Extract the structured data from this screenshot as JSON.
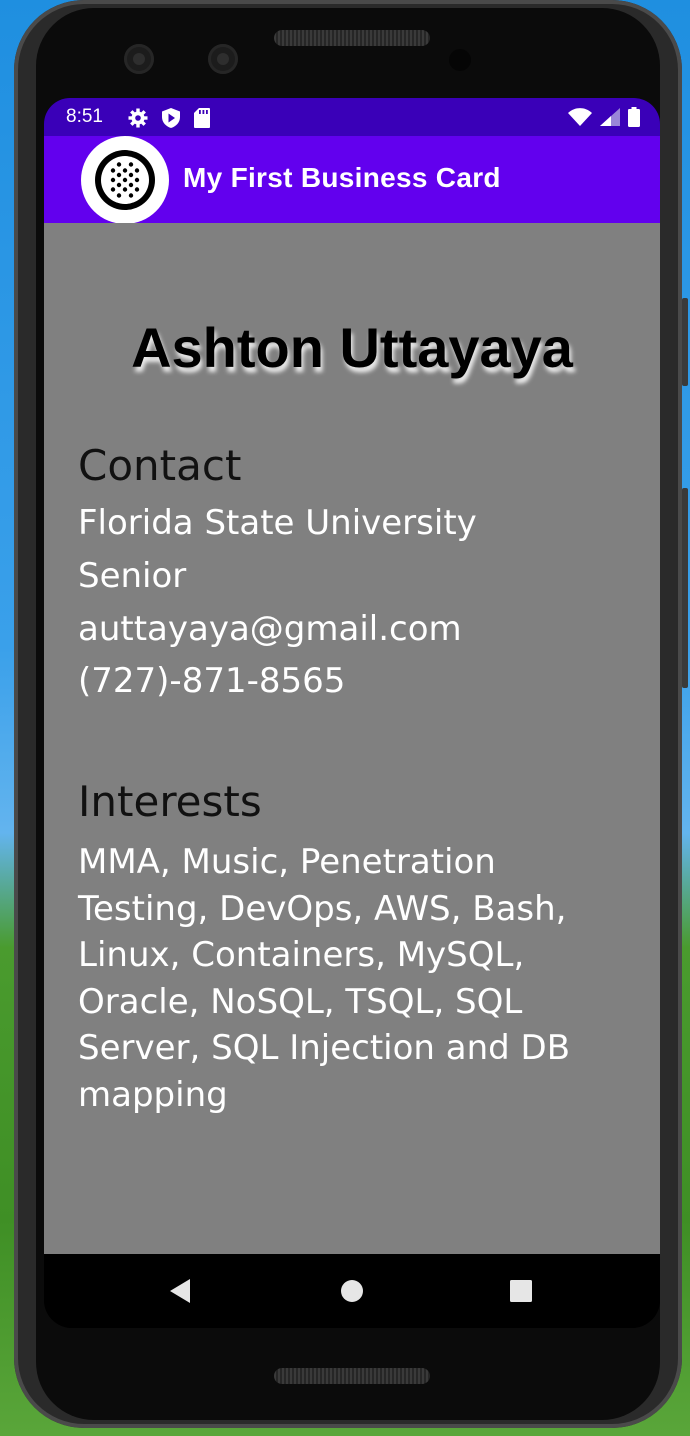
{
  "status_bar": {
    "time": "8:51",
    "left_icons": [
      "gear-icon",
      "shield-play-icon",
      "sd-card-icon"
    ],
    "right_icons": [
      "wifi-icon",
      "cell-signal-icon",
      "battery-icon"
    ]
  },
  "app_bar": {
    "title": "My First Business Card",
    "logo_icon": "android-logo-icon"
  },
  "card": {
    "name": "Ashton Uttayaya",
    "contact_heading": "Contact",
    "contact_lines": [
      "Florida State University",
      "Senior",
      "auttayaya@gmail.com",
      "(727)-871-8565"
    ],
    "interests_heading": "Interests",
    "interests_text": "MMA, Music, Penetration Testing, DevOps, AWS, Bash, Linux, Containers, MySQL, Oracle, NoSQL, TSQL, SQL Server, SQL Injection and DB mapping"
  },
  "nav_bar": {
    "buttons": [
      "back-icon",
      "home-icon",
      "recents-icon"
    ]
  },
  "colors": {
    "status_bar": "#3a00b8",
    "app_bar": "#6200ee",
    "content_bg": "#808080"
  }
}
